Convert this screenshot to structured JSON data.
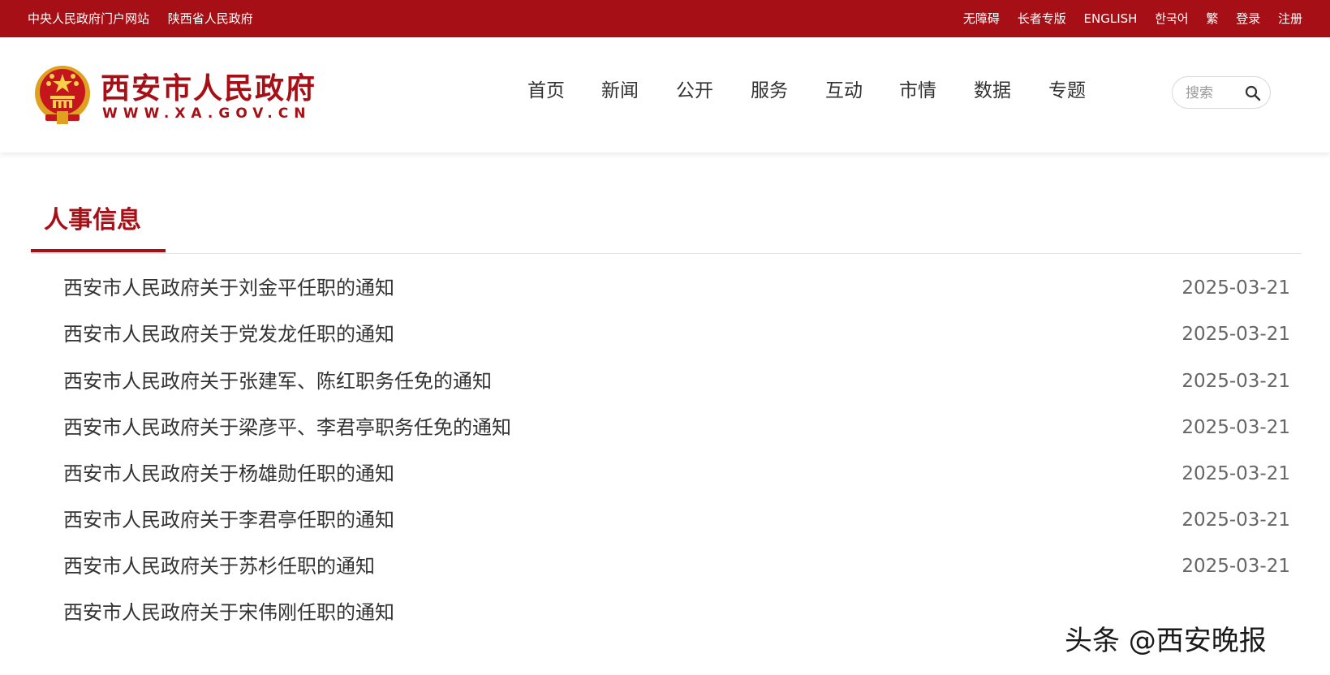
{
  "topbar": {
    "left_links": [
      "中央人民政府门户网站",
      "陕西省人民政府"
    ],
    "right_links": [
      "无障碍",
      "长者专版",
      "ENGLISH",
      "한국어",
      "繁",
      "登录",
      "注册"
    ]
  },
  "header": {
    "site_title": "西安市人民政府",
    "site_url": "WWW.XA.GOV.CN",
    "emblem_icon": "national-emblem-icon",
    "nav": [
      "首页",
      "新闻",
      "公开",
      "服务",
      "互动",
      "市情",
      "数据",
      "专题"
    ],
    "search": {
      "placeholder": "搜索",
      "icon": "search-icon"
    }
  },
  "colors": {
    "brand_red": "#a50f15"
  },
  "section": {
    "title": "人事信息",
    "items": [
      {
        "title": "西安市人民政府关于刘金平任职的通知",
        "date": "2025-03-21"
      },
      {
        "title": "西安市人民政府关于党发龙任职的通知",
        "date": "2025-03-21"
      },
      {
        "title": "西安市人民政府关于张建军、陈红职务任免的通知",
        "date": "2025-03-21"
      },
      {
        "title": "西安市人民政府关于梁彦平、李君亭职务任免的通知",
        "date": "2025-03-21"
      },
      {
        "title": "西安市人民政府关于杨雄勋任职的通知",
        "date": "2025-03-21"
      },
      {
        "title": "西安市人民政府关于李君亭任职的通知",
        "date": "2025-03-21"
      },
      {
        "title": "西安市人民政府关于苏杉任职的通知",
        "date": "2025-03-21"
      },
      {
        "title": "西安市人民政府关于宋伟刚任职的通知",
        "date": ""
      }
    ]
  },
  "watermark": "头条 @西安晚报"
}
